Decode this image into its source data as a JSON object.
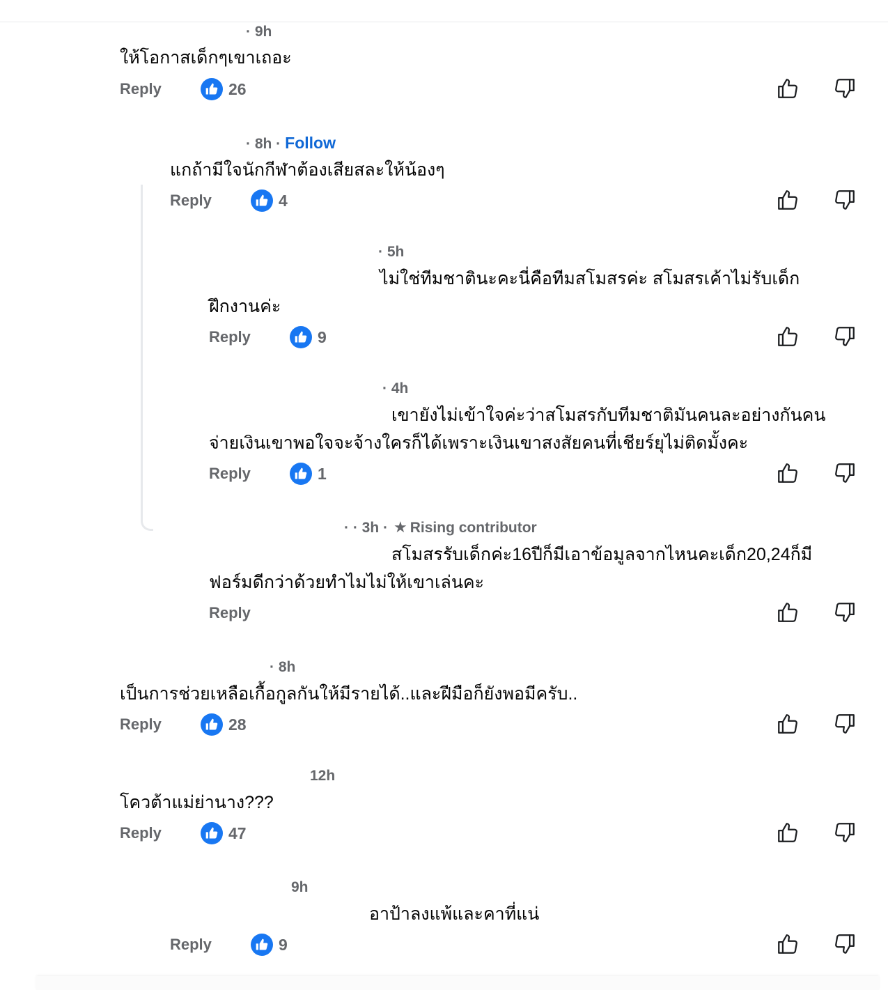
{
  "comments": [
    {
      "time": "· 9h",
      "text": [
        "ให้โอกาสเด็กๆเขาเถอะ"
      ],
      "reply": "Reply",
      "likes": "26"
    },
    {
      "time": "· 8h ·",
      "follow": "Follow",
      "text": [
        "แกถ้ามีใจนักกีฬาต้องเสียสละให้น้องๆ"
      ],
      "reply": "Reply",
      "likes": "4"
    },
    {
      "time": "· 5h",
      "text": [
        "ไม่ใช่ทีมชาตินะคะนี่คือทีมสโมสรค่ะ สโมสรเค้าไม่รับเด็ก",
        "ฝึกงานค่ะ"
      ],
      "reply": "Reply",
      "likes": "9"
    },
    {
      "time": "· 4h",
      "text": [
        "เขายังไม่เข้าใจค่ะว่าสโมสรกับทีมชาติมันคนละอย่างกันคน",
        "จ่ายเงินเขาพอใจจะจ้างใครก็ได้เพราะเงินเขาสงสัยคนที่เชียร์ยุไม่ติดมั้งคะ"
      ],
      "reply": "Reply",
      "likes": "1"
    },
    {
      "time": "· · 3h ·",
      "badge": "Rising contributor",
      "text": [
        "สโมสรรับเด็กค่ะ16ปีก็มีเอาข้อมูลจากไหนคะเด็ก20,24ก็มี",
        "ฟอร์มดีกว่าด้วยทำไมไม่ให้เขาเล่นคะ"
      ],
      "reply": "Reply",
      "likes": ""
    },
    {
      "time": "· 8h",
      "text": [
        "เป็นการช่วยเหลือเกื้อกูลกันให้มีรายได้..และฝีมือก็ยังพอมีครับ.."
      ],
      "reply": "Reply",
      "likes": "28"
    },
    {
      "time": "12h",
      "text": [
        "โควต้าแม่ย่านาง???"
      ],
      "reply": "Reply",
      "likes": "47"
    },
    {
      "time": "9h",
      "text": [
        "อาป้าลงแพ้และคาที่แน่"
      ],
      "reply": "Reply",
      "likes": "9"
    }
  ]
}
